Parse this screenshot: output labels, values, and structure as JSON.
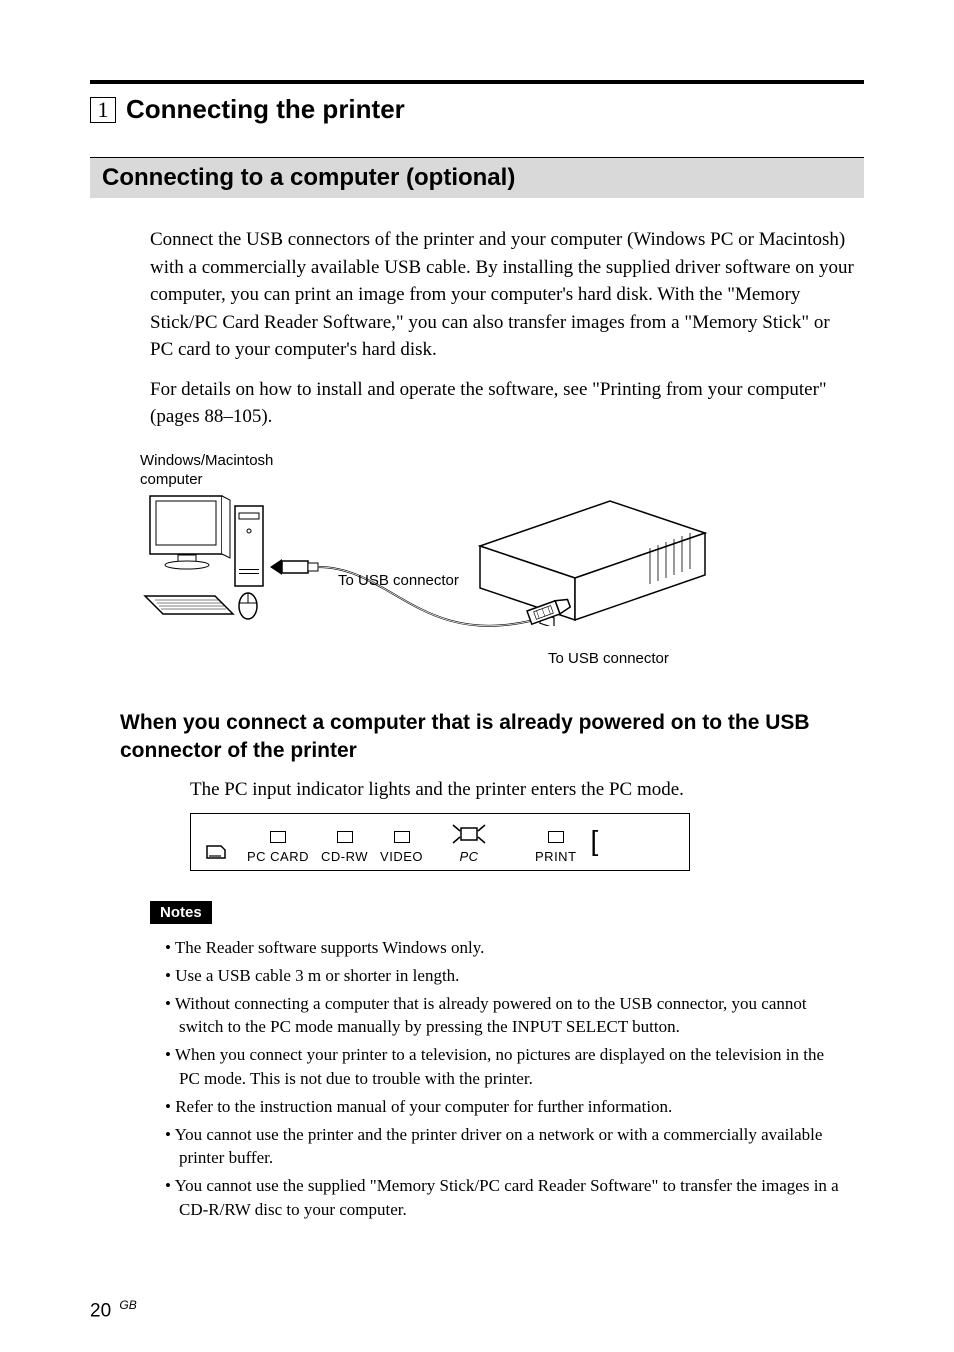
{
  "section": {
    "number": "1",
    "title": "Connecting the printer"
  },
  "subsection": {
    "title": "Connecting to a computer (optional)"
  },
  "paragraphs": {
    "p1": "Connect the USB connectors of the printer and your computer (Windows PC or Macintosh) with a commercially available USB cable.  By installing the supplied driver software on your computer, you can print an image from your computer's hard disk.   With the \"Memory Stick/PC Card Reader Software,\" you can also transfer images from a \"Memory Stick\" or PC card to your computer's hard disk.",
    "p2": "For details on how to install and operate the software, see \"Printing from your computer\" (pages 88–105)."
  },
  "diagram": {
    "computer_label": "Windows/Macintosh\ncomputer",
    "usb_label_top": "To USB connector",
    "usb_label_bottom": "To USB connector"
  },
  "subheading": "When you connect a computer that is already powered on to the USB connector of the printer",
  "subheading_text": "The PC input indicator lights and the printer enters the PC mode.",
  "indicator": {
    "items": [
      "PC CARD",
      "CD-RW",
      "VIDEO",
      "PC",
      "PRINT"
    ]
  },
  "notes": {
    "label": "Notes",
    "items": [
      "The Reader software supports Windows only.",
      "Use a USB cable 3 m or shorter in length.",
      "Without connecting a computer that is already powered on to the USB connector, you cannot switch to the PC mode manually by pressing the INPUT SELECT button.",
      "When you connect your printer to a television, no pictures are displayed on the television in the PC mode.  This is not due to trouble with the printer.",
      "Refer to the instruction manual of your computer for further information.",
      "You cannot use the printer and the printer driver on a network or with a commercially available printer buffer.",
      "You cannot use the supplied \"Memory Stick/PC card Reader Software\" to transfer the images in a CD-R/RW disc to your computer."
    ]
  },
  "page": {
    "number": "20",
    "suffix": "GB"
  }
}
